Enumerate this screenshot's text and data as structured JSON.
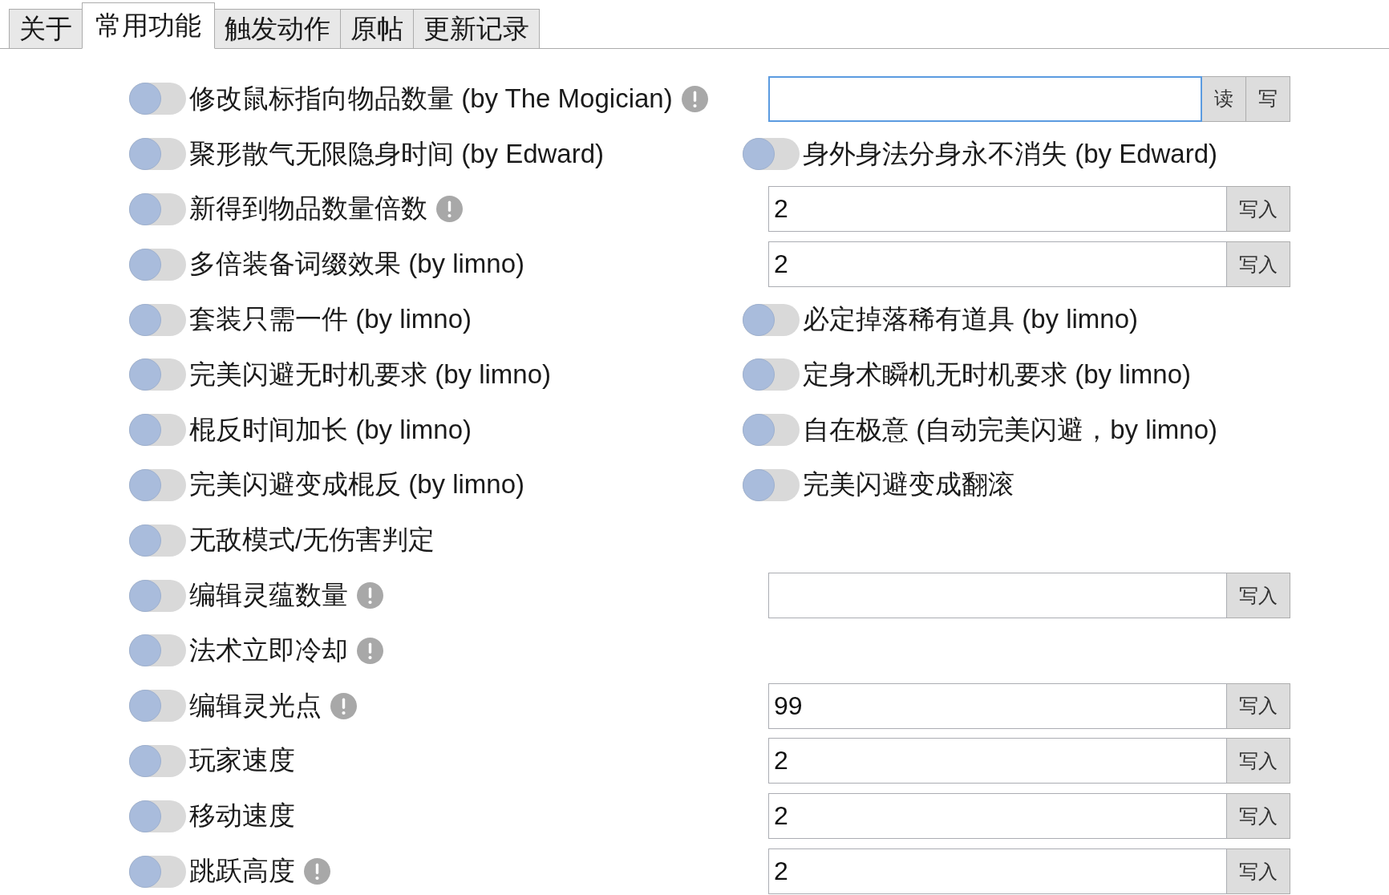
{
  "tabs": [
    {
      "label": "关于",
      "selected": false
    },
    {
      "label": "常用功能",
      "selected": true
    },
    {
      "label": "触发动作",
      "selected": false
    },
    {
      "label": "原帖",
      "selected": false
    },
    {
      "label": "更新记录",
      "selected": false
    }
  ],
  "rows": [
    {
      "left": {
        "label": "修改鼠标指向物品数量 (by The Mogician)",
        "on": false,
        "info": true
      },
      "right": {
        "kind": "input",
        "focused": true,
        "buttons": [
          "读",
          "写"
        ]
      }
    },
    {
      "left": {
        "label": "聚形散气无限隐身时间 (by Edward)",
        "on": false,
        "info": false
      },
      "right": {
        "kind": "toggle",
        "label": "身外身法分身永不消失 (by Edward)",
        "on": false
      }
    },
    {
      "left": {
        "label": "新得到物品数量倍数",
        "on": false,
        "info": true
      },
      "right": {
        "kind": "input",
        "value": "2",
        "focused": false,
        "buttons": [
          "写入"
        ]
      }
    },
    {
      "left": {
        "label": "多倍装备词缀效果 (by limno)",
        "on": false,
        "info": false
      },
      "right": {
        "kind": "input",
        "value": "2",
        "focused": false,
        "buttons": [
          "写入"
        ]
      }
    },
    {
      "left": {
        "label": "套装只需一件 (by limno)",
        "on": false,
        "info": false
      },
      "right": {
        "kind": "toggle",
        "label": "必定掉落稀有道具 (by limno)",
        "on": false
      }
    },
    {
      "left": {
        "label": "完美闪避无时机要求 (by limno)",
        "on": false,
        "info": false
      },
      "right": {
        "kind": "toggle",
        "label": "定身术瞬机无时机要求 (by limno)",
        "on": false
      }
    },
    {
      "left": {
        "label": "棍反时间加长 (by limno)",
        "on": false,
        "info": false
      },
      "right": {
        "kind": "toggle",
        "label": "自在极意 (自动完美闪避，by limno)",
        "on": false
      }
    },
    {
      "left": {
        "label": "完美闪避变成棍反 (by limno)",
        "on": false,
        "info": false
      },
      "right": {
        "kind": "toggle",
        "label": "完美闪避变成翻滚",
        "on": false
      }
    },
    {
      "left": {
        "label": "无敌模式/无伤害判定",
        "on": false,
        "info": false
      }
    },
    {
      "left": {
        "label": "编辑灵蕴数量",
        "on": false,
        "info": true
      },
      "right": {
        "kind": "input",
        "focused": false,
        "buttons": [
          "写入"
        ]
      }
    },
    {
      "left": {
        "label": "法术立即冷却",
        "on": false,
        "info": true
      }
    },
    {
      "left": {
        "label": "编辑灵光点",
        "on": false,
        "info": true
      },
      "right": {
        "kind": "input",
        "value": "99",
        "focused": false,
        "buttons": [
          "写入"
        ]
      }
    },
    {
      "left": {
        "label": "玩家速度",
        "on": false,
        "info": false
      },
      "right": {
        "kind": "input",
        "value": "2",
        "focused": false,
        "buttons": [
          "写入"
        ]
      }
    },
    {
      "left": {
        "label": "移动速度",
        "on": false,
        "info": false
      },
      "right": {
        "kind": "input",
        "value": "2",
        "focused": false,
        "buttons": [
          "写入"
        ]
      }
    },
    {
      "left": {
        "label": "跳跃高度",
        "on": false,
        "info": true
      },
      "right": {
        "kind": "input",
        "value": "2",
        "focused": false,
        "buttons": [
          "写入"
        ]
      }
    }
  ]
}
